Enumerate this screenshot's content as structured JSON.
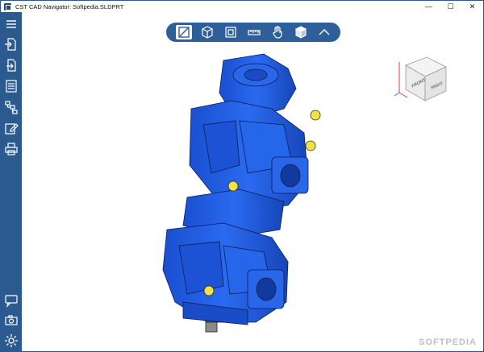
{
  "window": {
    "title": "CST CAD Navigator: Softpedia.SLDPRT",
    "minimize_glyph": "—",
    "maximize_glyph": "☐",
    "close_glyph": "✕"
  },
  "sidebar": {
    "items": [
      {
        "name": "menu-icon"
      },
      {
        "name": "open-file-icon"
      },
      {
        "name": "export-file-icon"
      },
      {
        "name": "properties-icon"
      },
      {
        "name": "model-tree-icon"
      },
      {
        "name": "edit-icon"
      },
      {
        "name": "print-icon"
      },
      {
        "name": "feedback-icon"
      },
      {
        "name": "camera-icon"
      },
      {
        "name": "settings-icon"
      }
    ]
  },
  "toolbar": {
    "items": [
      {
        "name": "display-mode-icon",
        "active": true
      },
      {
        "name": "view-cube-icon",
        "active": false
      },
      {
        "name": "fit-view-icon",
        "active": false
      },
      {
        "name": "measure-icon",
        "active": false
      },
      {
        "name": "pan-hand-icon",
        "active": false
      },
      {
        "name": "solid-shading-icon",
        "active": false
      },
      {
        "name": "collapse-toolbar-icon",
        "active": false
      }
    ]
  },
  "navcube": {
    "front_label": "FRONT",
    "right_label": "RIGHT"
  },
  "watermark": {
    "text": "SOFTPEDIA"
  },
  "colors": {
    "sidebar": "#2b5a8e",
    "toolbar": "#2f5f98",
    "model_blue": "#1f5fe0",
    "model_yellow": "#f1e14a"
  }
}
